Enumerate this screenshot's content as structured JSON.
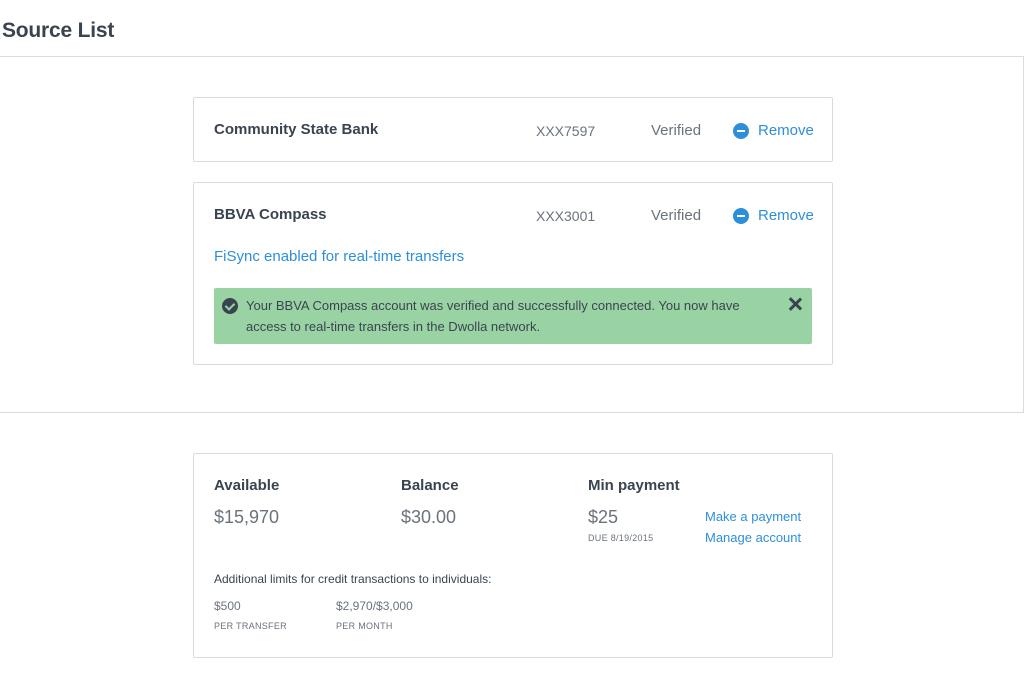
{
  "page": {
    "title": "Source List"
  },
  "sources": [
    {
      "name": "Community State Bank",
      "account": "XXX7597",
      "status": "Verified",
      "remove_label": "Remove"
    },
    {
      "name": "BBVA Compass",
      "account": "XXX3001",
      "status": "Verified",
      "remove_label": "Remove",
      "fisync_link": "FiSync enabled for real-time transfers",
      "alert": {
        "icon": "check-circle-icon",
        "text": "Your BBVA Compass account was verified and successfully connected. You now have access to real-time transfers in the Dwolla network.",
        "close_icon": "close-icon"
      }
    }
  ],
  "credit": {
    "available_label": "Available",
    "available_value": "$15,970",
    "balance_label": "Balance",
    "balance_value": "$30.00",
    "min_payment_label": "Min payment",
    "min_payment_value": "$25",
    "due_text": "DUE 8/19/2015",
    "make_payment_link": "Make a payment",
    "manage_account_link": "Manage account",
    "limits_note": "Additional limits for credit transactions to individuals:",
    "limits": [
      {
        "value": "$500",
        "label": "PER TRANSFER"
      },
      {
        "value": "$2,970/$3,000",
        "label": "PER MONTH"
      }
    ]
  },
  "colors": {
    "accent": "#2d8fd9",
    "success_bg": "#9ad3a3",
    "text": "#3a4450",
    "muted": "#6a737d",
    "border": "#d6dbe0"
  }
}
